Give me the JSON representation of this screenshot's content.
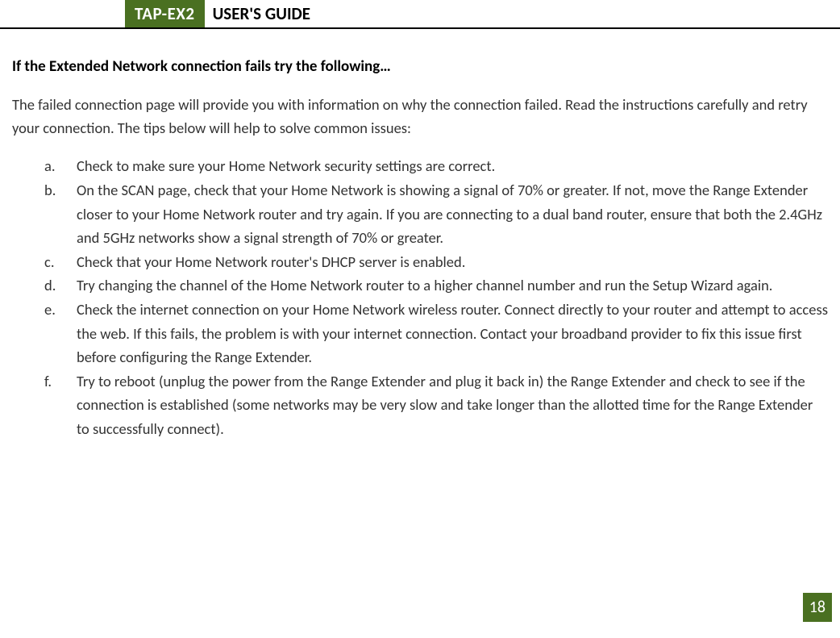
{
  "header": {
    "product": "TAP-EX2",
    "title": "USER'S GUIDE"
  },
  "section": {
    "heading": "If the Extended Network connection fails try the following…",
    "intro": "The failed connection page will provide you with information on why the connection failed. Read the instructions carefully and retry your connection. The tips below will help to solve common issues:"
  },
  "tips": [
    {
      "marker": "a.",
      "text": "Check to make sure your Home Network security settings are correct."
    },
    {
      "marker": "b.",
      "text": "On the SCAN page, check that your Home Network is showing a signal of 70% or greater. If not, move the Range Extender closer to your Home Network router and try again. If you are connecting to a dual band router, ensure that both the 2.4GHz and 5GHz networks show a signal strength of 70% or greater."
    },
    {
      "marker": "c.",
      "text": "Check that your Home Network router's DHCP server is enabled."
    },
    {
      "marker": "d.",
      "text": "Try changing the channel of the Home Network router to a higher channel number and run the Setup Wizard again."
    },
    {
      "marker": "e.",
      "text": "Check the internet connection on your Home Network wireless router. Connect directly to your router and attempt to access the web.  If this fails, the problem is with your internet connection.  Contact your broadband provider to fix this issue first before configuring the Range Extender."
    },
    {
      "marker": "f.",
      "text": "Try to reboot (unplug the power from the Range Extender and plug it back in) the Range Extender and check to see if the connection is established (some networks may be very slow and take longer than the allotted time for the Range Extender to successfully connect)."
    }
  ],
  "page_number": "18"
}
